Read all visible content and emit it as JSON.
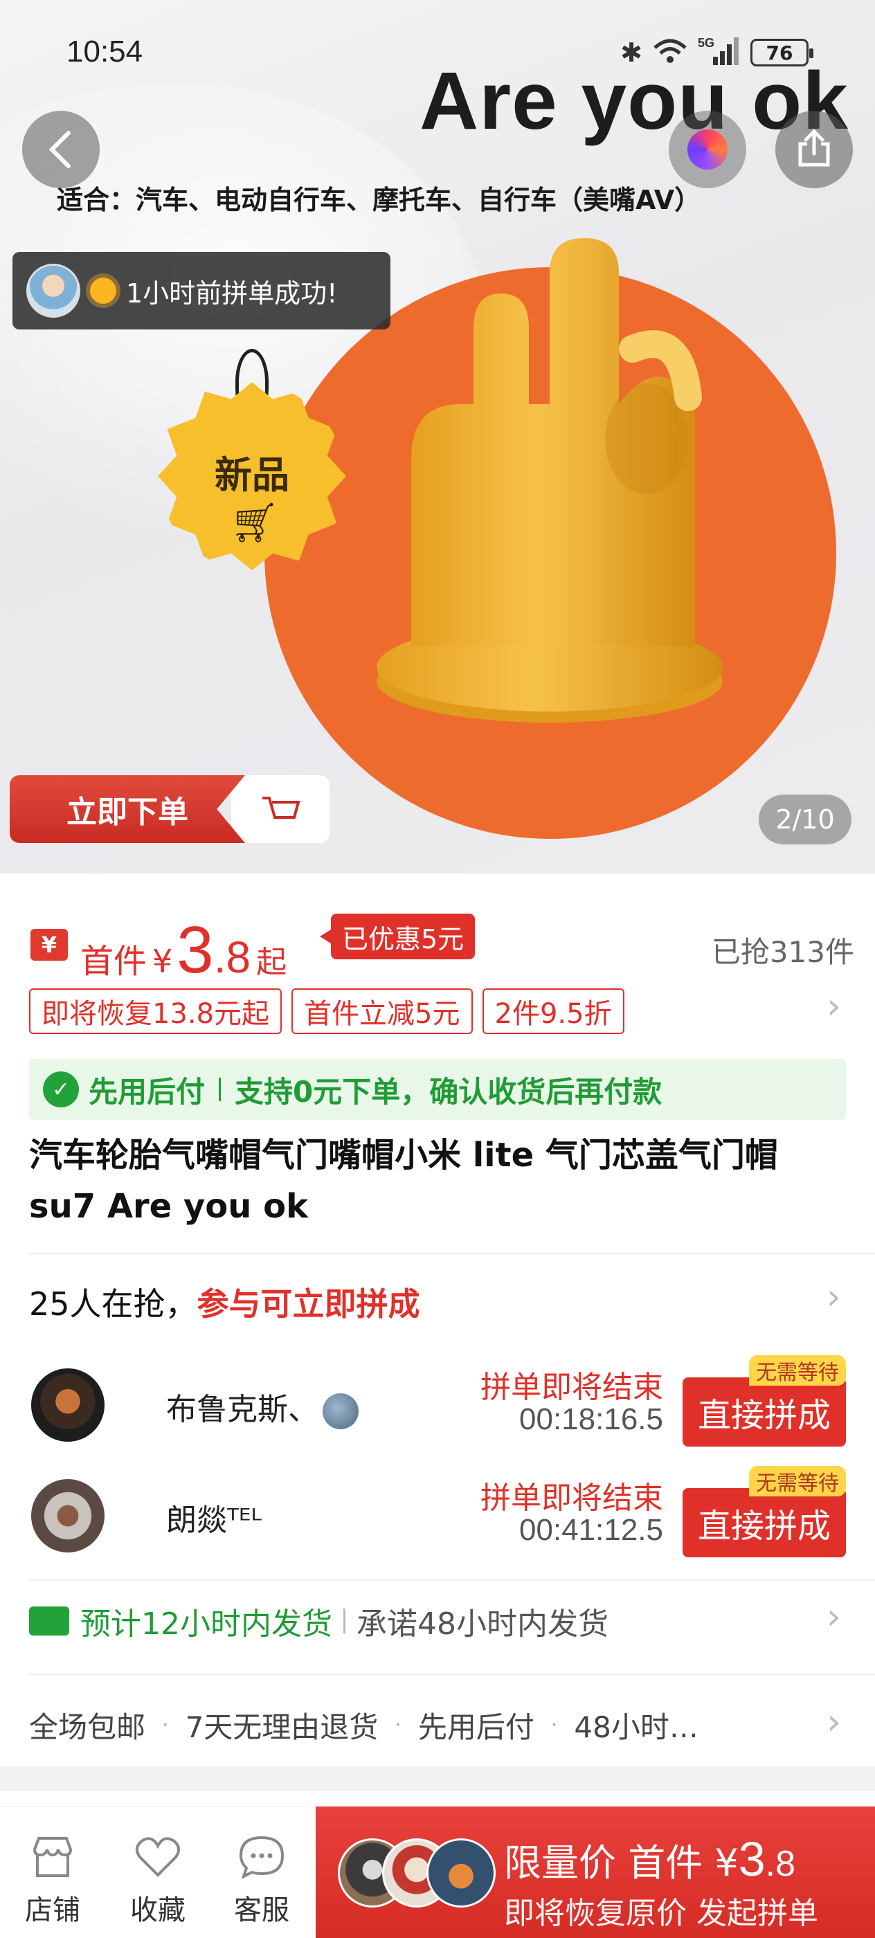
{
  "status_bar": {
    "time": "10:54",
    "battery": "76"
  },
  "hero": {
    "ad_title": "Are you ok",
    "ad_subtitle": "适合：汽车、电动自行车、摩托车、自行车（美嘴AV）",
    "toast": "1小时前拼单成功!",
    "new_tag": "新品",
    "buy_banner": "立即下单",
    "counter": "2/10"
  },
  "price": {
    "prefix": "首件",
    "symbol": "¥",
    "integer": "3",
    "decimal": ".8",
    "suffix": "起",
    "saved_badge": "已优惠5元",
    "sold": "已抢313件"
  },
  "promos": [
    "即将恢复13.8元起",
    "首件立减5元",
    "2件9.5折"
  ],
  "pay_later": {
    "label": "先用后付",
    "desc": "支持0元下单，确认收货后再付款"
  },
  "product_title": "汽车轮胎气嘴帽气门嘴帽小米 lite 气门芯盖气门帽 su7 Are you ok",
  "group_buy": {
    "count_text": "25人在抢，",
    "cta_text": "参与可立即拼成",
    "rows": [
      {
        "name": "布鲁克斯、",
        "ending": "拼单即将结束",
        "timer": "00:18:16.5",
        "join": "直接拼成",
        "badge": "无需等待"
      },
      {
        "name": "朗燚ᵀᴱᴸ",
        "ending": "拼单即将结束",
        "timer": "00:41:12.5",
        "join": "直接拼成",
        "badge": "无需等待"
      }
    ]
  },
  "shipping": {
    "highlight": "预计12小时内发货",
    "promise": "承诺48小时内发货"
  },
  "services": [
    "全场包邮",
    "7天无理由退货",
    "先用后付",
    "48小时…"
  ],
  "bottom_bar": {
    "store": "店铺",
    "favorite": "收藏",
    "service": "客服",
    "cta_line1_a": "限量价 首件",
    "cta_symbol": "¥",
    "cta_int": "3",
    "cta_dec": ".8",
    "cta_line2": "即将恢复原价 发起拼单"
  },
  "colors": {
    "accent_red": "#e0302a",
    "green": "#1f9c35",
    "product_orange": "#ee6b2e"
  }
}
